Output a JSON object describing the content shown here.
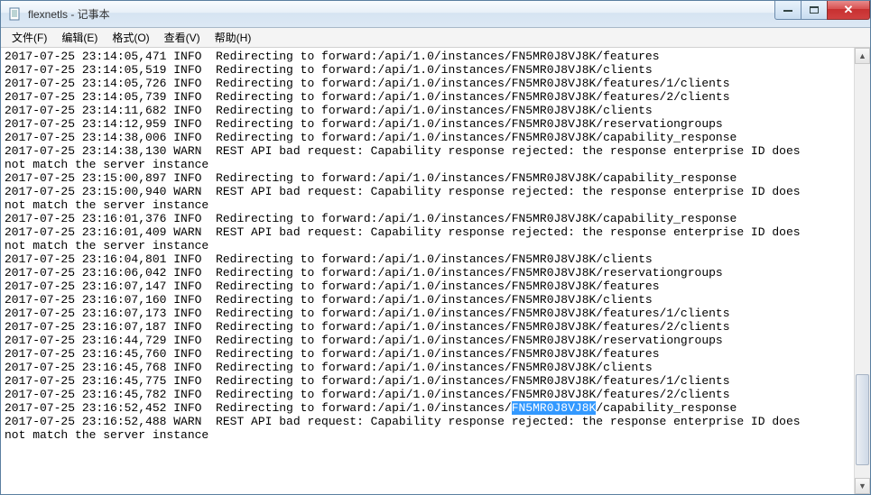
{
  "titlebar": {
    "title": "flexnetls - 记事本"
  },
  "menus": [
    {
      "label": "文件(F)"
    },
    {
      "label": "编辑(E)"
    },
    {
      "label": "格式(O)"
    },
    {
      "label": "查看(V)"
    },
    {
      "label": "帮助(H)"
    }
  ],
  "highlighted_instance": "FN5MR0J8VJ8K",
  "log_lines": [
    {
      "ts": "2017-07-25 23:14:05,471",
      "lvl": "INFO",
      "msg": "Redirecting to forward:/api/1.0/instances/FN5MR0J8VJ8K/features"
    },
    {
      "ts": "2017-07-25 23:14:05,519",
      "lvl": "INFO",
      "msg": "Redirecting to forward:/api/1.0/instances/FN5MR0J8VJ8K/clients"
    },
    {
      "ts": "2017-07-25 23:14:05,726",
      "lvl": "INFO",
      "msg": "Redirecting to forward:/api/1.0/instances/FN5MR0J8VJ8K/features/1/clients"
    },
    {
      "ts": "2017-07-25 23:14:05,739",
      "lvl": "INFO",
      "msg": "Redirecting to forward:/api/1.0/instances/FN5MR0J8VJ8K/features/2/clients"
    },
    {
      "ts": "2017-07-25 23:14:11,682",
      "lvl": "INFO",
      "msg": "Redirecting to forward:/api/1.0/instances/FN5MR0J8VJ8K/clients"
    },
    {
      "ts": "2017-07-25 23:14:12,959",
      "lvl": "INFO",
      "msg": "Redirecting to forward:/api/1.0/instances/FN5MR0J8VJ8K/reservationgroups"
    },
    {
      "ts": "2017-07-25 23:14:38,006",
      "lvl": "INFO",
      "msg": "Redirecting to forward:/api/1.0/instances/FN5MR0J8VJ8K/capability_response"
    },
    {
      "ts": "2017-07-25 23:14:38,130",
      "lvl": "WARN",
      "msg": "REST API bad request: Capability response rejected: the response enterprise ID does",
      "wrap": "not match the server instance"
    },
    {
      "ts": "2017-07-25 23:15:00,897",
      "lvl": "INFO",
      "msg": "Redirecting to forward:/api/1.0/instances/FN5MR0J8VJ8K/capability_response"
    },
    {
      "ts": "2017-07-25 23:15:00,940",
      "lvl": "WARN",
      "msg": "REST API bad request: Capability response rejected: the response enterprise ID does",
      "wrap": "not match the server instance"
    },
    {
      "ts": "2017-07-25 23:16:01,376",
      "lvl": "INFO",
      "msg": "Redirecting to forward:/api/1.0/instances/FN5MR0J8VJ8K/capability_response"
    },
    {
      "ts": "2017-07-25 23:16:01,409",
      "lvl": "WARN",
      "msg": "REST API bad request: Capability response rejected: the response enterprise ID does",
      "wrap": "not match the server instance"
    },
    {
      "ts": "2017-07-25 23:16:04,801",
      "lvl": "INFO",
      "msg": "Redirecting to forward:/api/1.0/instances/FN5MR0J8VJ8K/clients"
    },
    {
      "ts": "2017-07-25 23:16:06,042",
      "lvl": "INFO",
      "msg": "Redirecting to forward:/api/1.0/instances/FN5MR0J8VJ8K/reservationgroups"
    },
    {
      "ts": "2017-07-25 23:16:07,147",
      "lvl": "INFO",
      "msg": "Redirecting to forward:/api/1.0/instances/FN5MR0J8VJ8K/features"
    },
    {
      "ts": "2017-07-25 23:16:07,160",
      "lvl": "INFO",
      "msg": "Redirecting to forward:/api/1.0/instances/FN5MR0J8VJ8K/clients"
    },
    {
      "ts": "2017-07-25 23:16:07,173",
      "lvl": "INFO",
      "msg": "Redirecting to forward:/api/1.0/instances/FN5MR0J8VJ8K/features/1/clients"
    },
    {
      "ts": "2017-07-25 23:16:07,187",
      "lvl": "INFO",
      "msg": "Redirecting to forward:/api/1.0/instances/FN5MR0J8VJ8K/features/2/clients"
    },
    {
      "ts": "2017-07-25 23:16:44,729",
      "lvl": "INFO",
      "msg": "Redirecting to forward:/api/1.0/instances/FN5MR0J8VJ8K/reservationgroups"
    },
    {
      "ts": "2017-07-25 23:16:45,760",
      "lvl": "INFO",
      "msg": "Redirecting to forward:/api/1.0/instances/FN5MR0J8VJ8K/features"
    },
    {
      "ts": "2017-07-25 23:16:45,768",
      "lvl": "INFO",
      "msg": "Redirecting to forward:/api/1.0/instances/FN5MR0J8VJ8K/clients"
    },
    {
      "ts": "2017-07-25 23:16:45,775",
      "lvl": "INFO",
      "msg": "Redirecting to forward:/api/1.0/instances/FN5MR0J8VJ8K/features/1/clients"
    },
    {
      "ts": "2017-07-25 23:16:45,782",
      "lvl": "INFO",
      "msg": "Redirecting to forward:/api/1.0/instances/FN5MR0J8VJ8K/features/2/clients"
    },
    {
      "ts": "2017-07-25 23:16:52,452",
      "lvl": "INFO",
      "msg_pre": "Redirecting to forward:/api/1.0/instances/",
      "msg_hl": "FN5MR0J8VJ8K",
      "msg_post": "/capability_response",
      "highlight": true
    },
    {
      "ts": "2017-07-25 23:16:52,488",
      "lvl": "WARN",
      "msg": "REST API bad request: Capability response rejected: the response enterprise ID does",
      "wrap": "not match the server instance"
    }
  ],
  "scrollbar": {
    "thumb_top_pct": 75,
    "thumb_height_pct": 22
  }
}
